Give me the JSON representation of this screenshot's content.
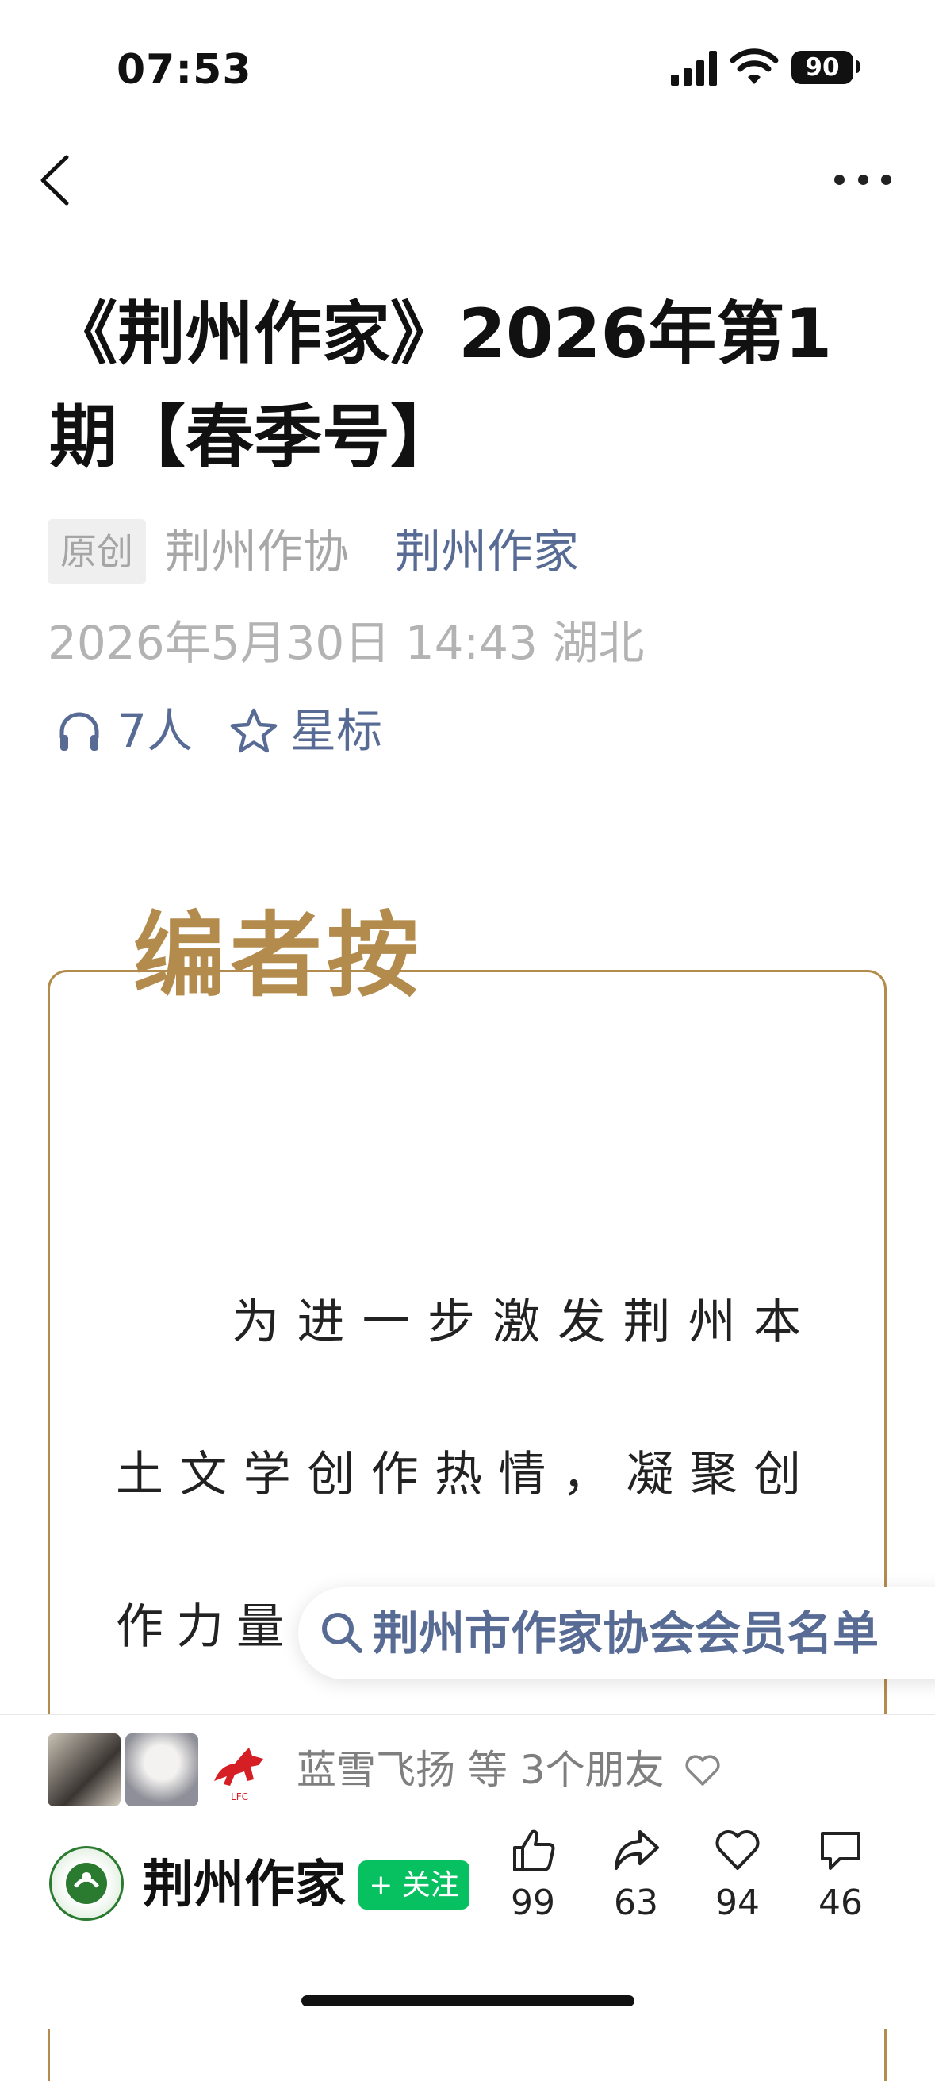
{
  "status_bar": {
    "time": "07:53",
    "battery": "90"
  },
  "article": {
    "title": "《荆州作家》2026年第1期【春季号】",
    "tag": "原创",
    "author": "荆州作协",
    "account": "荆州作家",
    "datetime": "2026年5月30日 14:43 湖北",
    "listeners": "7人",
    "star_label": "星标"
  },
  "editor_note": {
    "heading": "编者按",
    "text": "为进一步激发荆州本土文学创作热情，凝聚创作力量，市作协"
  },
  "search_chip": {
    "text": "荆州市作家协会会员名单"
  },
  "bottom_bar": {
    "friends_text": "蓝雪飞扬 等 3个朋友",
    "account_name": "荆州作家",
    "follow_label": "+ 关注",
    "actions": {
      "like": "99",
      "share": "63",
      "heart": "94",
      "comment": "46"
    }
  },
  "icons": [
    "back-icon",
    "more-icon",
    "headphones-icon",
    "star-icon",
    "search-icon",
    "heart-icon",
    "thumbs-up-icon",
    "share-icon",
    "comment-icon"
  ]
}
